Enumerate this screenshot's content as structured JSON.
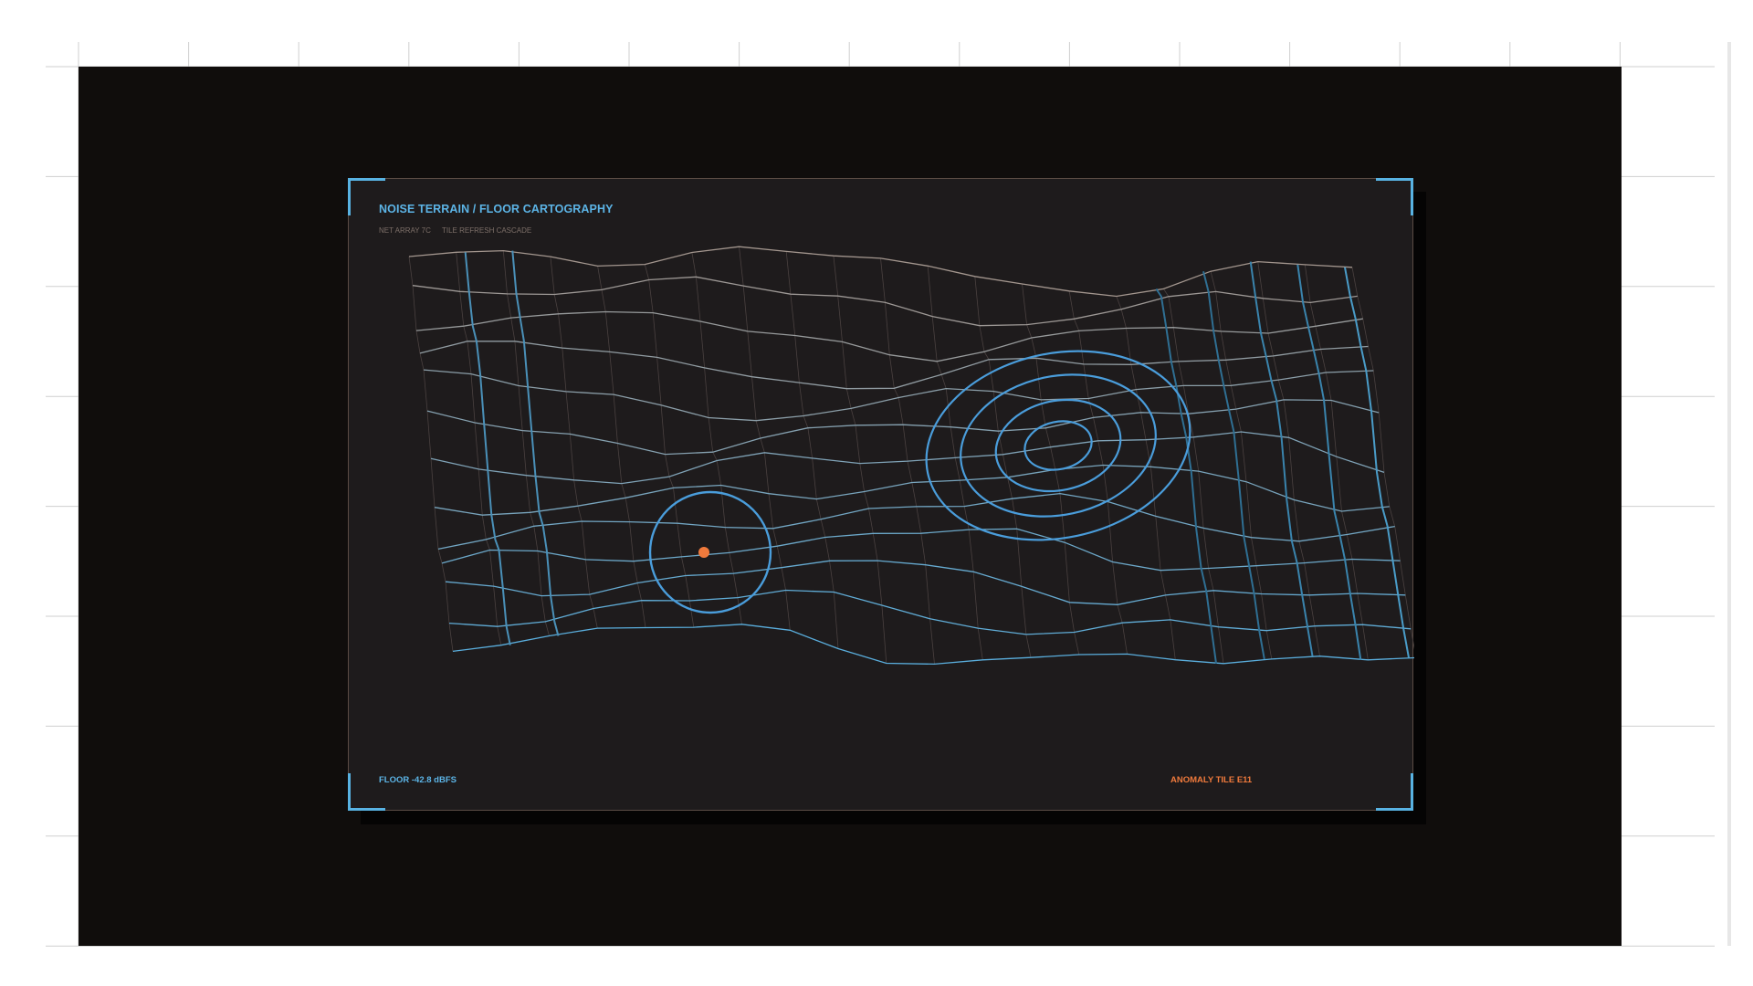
{
  "panel": {
    "title": "NOISE TERRAIN / FLOOR CARTOGRAPHY",
    "meta": [
      "NET ARRAY 7C",
      "TILE REFRESH CASCADE"
    ],
    "floor_label": "FLOOR -42.8 dBFS",
    "anomaly_label": "ANOMALY TILE E11"
  },
  "colors": {
    "page_bg": "#ffffff",
    "stage_bg": "#100d0c",
    "panel_bg": "#1e1b1c",
    "accent_blue": "#58b2e2",
    "accent_orange": "#f07a3c",
    "grid_warm": "#a3968e",
    "grid_cool": "#5aaedd"
  },
  "icons": {
    "anomaly_marker": "anomaly-dot-icon",
    "corner_brackets": "corner-bracket-icon"
  }
}
